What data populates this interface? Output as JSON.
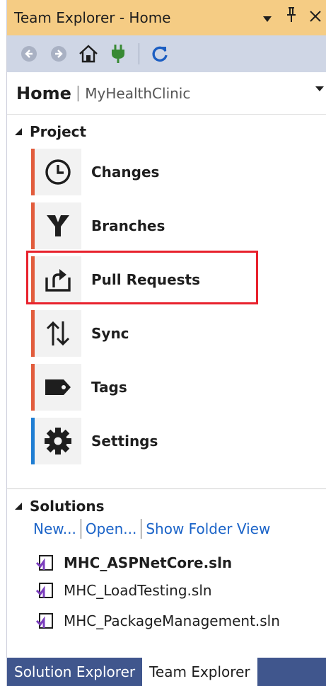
{
  "window": {
    "title": "Team Explorer - Home",
    "controls": [
      "▾",
      "ᵖ",
      "✕"
    ]
  },
  "toolbar": {
    "icons": [
      "back-icon",
      "forward-icon",
      "home-icon",
      "connect-icon",
      "refresh-icon"
    ]
  },
  "home": {
    "title": "Home",
    "separator": "|",
    "project": "MyHealthClinic"
  },
  "project_section": {
    "label": "Project",
    "items": [
      {
        "label": "Changes",
        "icon": "clock-icon",
        "accent": "#e25c3c"
      },
      {
        "label": "Branches",
        "icon": "branch-icon",
        "accent": "#e25c3c"
      },
      {
        "label": "Pull Requests",
        "icon": "pull-request-icon",
        "accent": "#e25c3c"
      },
      {
        "label": "Sync",
        "icon": "sync-icon",
        "accent": "#e25c3c"
      },
      {
        "label": "Tags",
        "icon": "tag-icon",
        "accent": "#e25c3c"
      },
      {
        "label": "Settings",
        "icon": "gear-icon",
        "accent": "#1f7ed3"
      }
    ]
  },
  "solutions_section": {
    "label": "Solutions",
    "links": [
      "New...",
      "Open...",
      "Show Folder View"
    ],
    "files": [
      {
        "name": "MHC_ASPNetCore.sln",
        "bold": true
      },
      {
        "name": "MHC_LoadTesting.sln",
        "bold": false
      },
      {
        "name": "MHC_PackageManagement.sln",
        "bold": false
      }
    ]
  },
  "tabs": [
    {
      "label": "Solution Explorer",
      "active": false
    },
    {
      "label": "Team Explorer",
      "active": true
    }
  ],
  "colors": {
    "title_bar": "#f5cc84",
    "toolbar": "#cfd6e5",
    "accent_red": "#e25c3c",
    "accent_blue": "#1f7ed3",
    "highlight": "#e8222d",
    "link": "#1a63c8",
    "tab_bar": "#40568d"
  }
}
